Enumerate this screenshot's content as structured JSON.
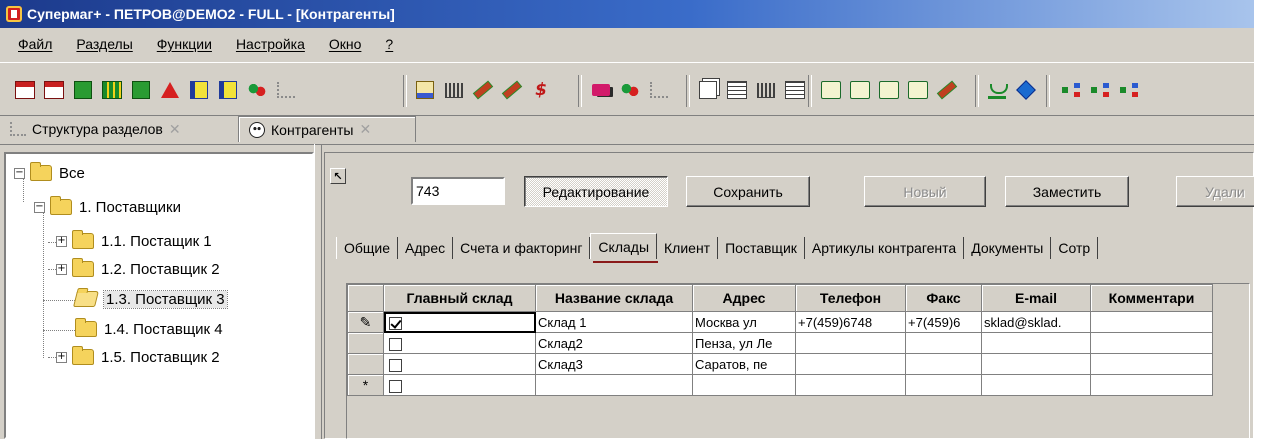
{
  "window": {
    "title": "Супермаг+ - ПЕТРОВ@DEMO2 - FULL - [Контрагенты]"
  },
  "menu": [
    "Файл",
    "Разделы",
    "Функции",
    "Настройка",
    "Окно",
    "?"
  ],
  "toolbar": {
    "icons": [
      "document-red-icon",
      "document-red-icon",
      "book-green-icon",
      "grid-green-icon",
      "book-green-icon",
      "triangle-red-icon",
      "flag-icon",
      "flag-icon",
      "people-icon",
      "tree-icon",
      "sheet-icon",
      "indent-icon",
      "pen-icon",
      "pen-icon",
      "dollar-icon",
      "truck-icon",
      "people-icon",
      "tree-icon",
      "window-icon",
      "table-icon",
      "bars-icon",
      "list-icon",
      "chat-icon",
      "chat-icon",
      "chat-icon",
      "chat-icon",
      "pen-icon",
      "scale-icon",
      "diamond-icon",
      "org-icon",
      "org-icon",
      "org-icon"
    ]
  },
  "doctabs": [
    {
      "label": "Структура разделов",
      "icon": "tree-icon"
    },
    {
      "label": "Контрагенты",
      "icon": "smile-icon"
    }
  ],
  "tree": [
    {
      "label": "Все",
      "level": 0,
      "expander": "−"
    },
    {
      "label": "1. Поставщики",
      "level": 1,
      "expander": "−"
    },
    {
      "label": "1.1. Постащик 1",
      "level": 2,
      "expander": "+"
    },
    {
      "label": "1.2. Поставщик 2",
      "level": 2,
      "expander": "+"
    },
    {
      "label": "1.3. Поставщик 3",
      "level": 2,
      "expander": "",
      "selected": true
    },
    {
      "label": "1.4. Поставщик 4",
      "level": 2,
      "expander": ""
    },
    {
      "label": "1.5. Поставщик 2",
      "level": 2,
      "expander": "+"
    }
  ],
  "record": {
    "id": "743",
    "buttons": {
      "edit": "Редактирование",
      "save": "Сохранить",
      "new": "Новый",
      "replace": "Заместить",
      "delete": "Удали"
    }
  },
  "subtabs": [
    "Общие",
    "Адрес",
    "Счета и факторинг",
    "Склады",
    "Клиент",
    "Поставщик",
    "Артикулы контрагента",
    "Документы",
    "Сотр"
  ],
  "active_subtab": "Склады",
  "grid": {
    "columns": [
      "Главный склад",
      "Название склада",
      "Адрес",
      "Телефон",
      "Факс",
      "E-mail",
      "Комментари"
    ],
    "rows": [
      {
        "indicator": "✎",
        "main": true,
        "name": " Склад 1",
        "address": "Москва ул",
        "phone": "+7(459)6748",
        "fax": "+7(459)6",
        "email": "sklad@sklad.",
        "comment": ""
      },
      {
        "indicator": "",
        "main": false,
        "name": "Склад2",
        "address": "Пенза, ул Ле",
        "phone": "",
        "fax": "",
        "email": "",
        "comment": ""
      },
      {
        "indicator": "",
        "main": false,
        "name": "Склад3",
        "address": "Саратов, пе",
        "phone": "",
        "fax": "",
        "email": "",
        "comment": ""
      },
      {
        "indicator": "*",
        "main": false,
        "name": "",
        "address": "",
        "phone": "",
        "fax": "",
        "email": "",
        "comment": ""
      }
    ]
  }
}
